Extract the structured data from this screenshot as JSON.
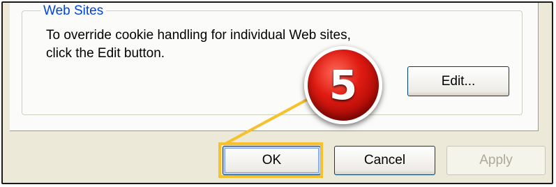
{
  "group": {
    "title": "Web Sites",
    "description_line1": "To override cookie handling for individual Web sites,",
    "description_line2": "click the Edit button."
  },
  "buttons": {
    "edit": "Edit...",
    "ok": "OK",
    "cancel": "Cancel",
    "apply": "Apply"
  },
  "callout": {
    "step_number": "5",
    "circle_color": "#d9140e",
    "highlight_color": "#f7c12e"
  }
}
